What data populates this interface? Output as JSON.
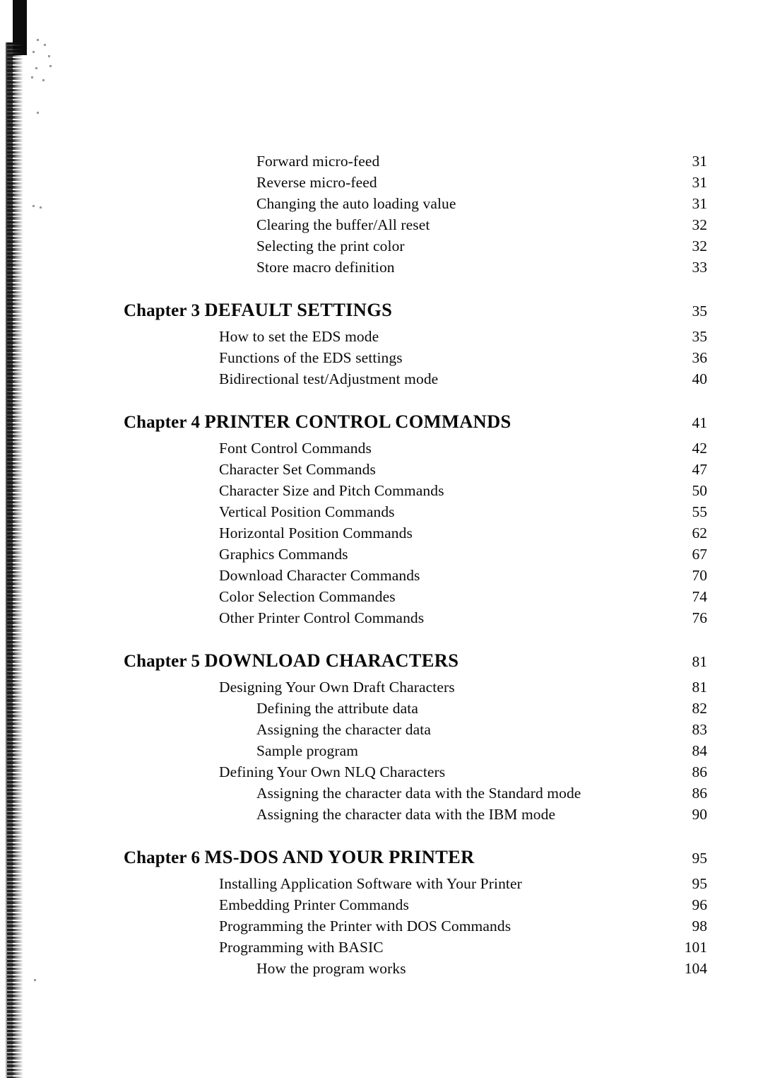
{
  "page": {
    "background_color": "#ffffff",
    "text_color": "#0a0a0a",
    "document_type": "table-of-contents"
  },
  "toc": {
    "entries": [
      {
        "level": 2,
        "label": "Forward micro-feed",
        "page": "31"
      },
      {
        "level": 2,
        "label": "Reverse micro-feed",
        "page": "31"
      },
      {
        "level": 2,
        "label": "Changing the auto loading value",
        "page": "31"
      },
      {
        "level": 2,
        "label": "Clearing the buffer/All reset",
        "page": "32"
      },
      {
        "level": 2,
        "label": "Selecting the print color",
        "page": "32"
      },
      {
        "level": 2,
        "label": "Store macro definition",
        "page": "33"
      },
      {
        "level": 0,
        "chapter_label": "Chapter 3",
        "title": "DEFAULT SETTINGS",
        "page": "35"
      },
      {
        "level": 1,
        "label": "How to set the EDS mode",
        "page": "35"
      },
      {
        "level": 1,
        "label": "Functions of the EDS settings",
        "page": "36"
      },
      {
        "level": 1,
        "label": "Bidirectional test/Adjustment mode",
        "page": "40"
      },
      {
        "level": 0,
        "chapter_label": "Chapter 4",
        "title": "PRINTER CONTROL COMMANDS",
        "page": "41"
      },
      {
        "level": 1,
        "label": "Font Control Commands",
        "page": "42"
      },
      {
        "level": 1,
        "label": "Character Set Commands",
        "page": "47"
      },
      {
        "level": 1,
        "label": "Character Size and Pitch Commands",
        "page": "50"
      },
      {
        "level": 1,
        "label": "Vertical Position Commands",
        "page": "55"
      },
      {
        "level": 1,
        "label": "Horizontal Position Commands",
        "page": "62"
      },
      {
        "level": 1,
        "label": "Graphics Commands",
        "page": "67"
      },
      {
        "level": 1,
        "label": "Download Character Commands",
        "page": "70"
      },
      {
        "level": 1,
        "label": "Color Selection Commandes",
        "page": "74"
      },
      {
        "level": 1,
        "label": "Other Printer Control Commands",
        "page": "76"
      },
      {
        "level": 0,
        "chapter_label": "Chapter 5",
        "title": "DOWNLOAD CHARACTERS",
        "page": "81"
      },
      {
        "level": 1,
        "label": "Designing Your Own Draft Characters",
        "page": "81"
      },
      {
        "level": 2,
        "label": "Defining the attribute data",
        "page": "82"
      },
      {
        "level": 2,
        "label": "Assigning the character data",
        "page": "83"
      },
      {
        "level": 2,
        "label": "Sample program",
        "page": "84"
      },
      {
        "level": 1,
        "label": "Defining Your Own NLQ Characters",
        "page": "86"
      },
      {
        "level": 2,
        "label": "Assigning the character data with the Standard mode",
        "page": "86"
      },
      {
        "level": 2,
        "label": "Assigning the character data with the IBM mode",
        "page": "90"
      },
      {
        "level": 0,
        "chapter_label": "Chapter 6",
        "title": "MS-DOS AND YOUR PRINTER",
        "page": "95"
      },
      {
        "level": 1,
        "label": "Installing Application Software with Your Printer",
        "page": "95"
      },
      {
        "level": 1,
        "label": "Embedding Printer Commands",
        "page": "96"
      },
      {
        "level": 1,
        "label": "Programming the Printer with DOS Commands",
        "page": "98"
      },
      {
        "level": 1,
        "label": "Programming with BASIC",
        "page": "101"
      },
      {
        "level": 2,
        "label": "How the program works",
        "page": "104"
      }
    ]
  }
}
